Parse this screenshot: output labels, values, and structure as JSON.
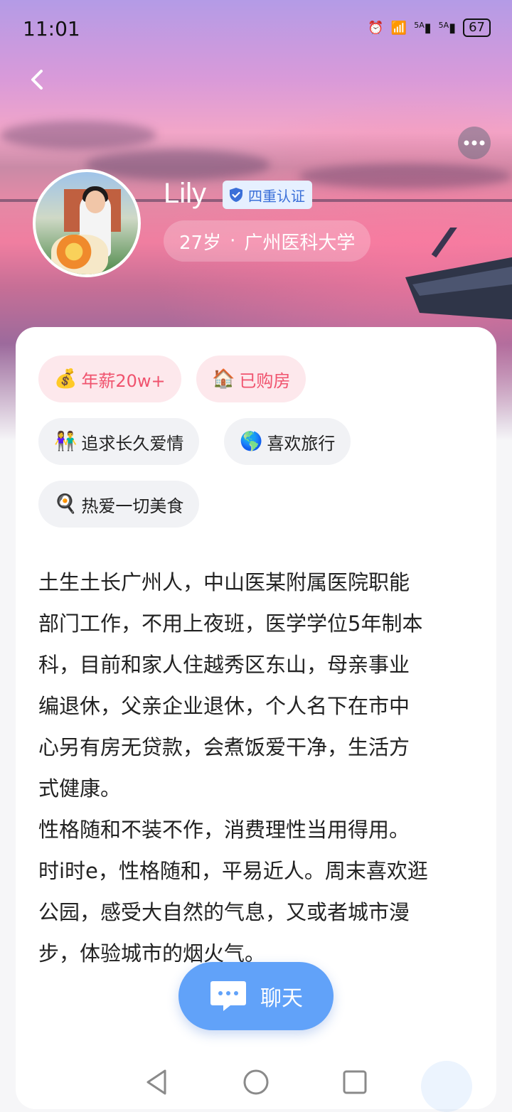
{
  "status_bar": {
    "time": "11:01",
    "signal1": "5A",
    "signal2": "5A",
    "battery": "67"
  },
  "profile": {
    "name": "Lily",
    "verification": "四重认证",
    "age": "27岁",
    "separator": "·",
    "school": "广州医科大学"
  },
  "tags": [
    {
      "emoji": "💰",
      "label": "年薪20w+",
      "style": "pink"
    },
    {
      "emoji": "🏠",
      "label": "已购房",
      "style": "pink"
    },
    {
      "emoji": "👫",
      "label": "追求长久爱情",
      "style": "grey"
    },
    {
      "emoji": "🌎",
      "label": "喜欢旅行",
      "style": "grey"
    },
    {
      "emoji": "🍳",
      "label": "热爱一切美食",
      "style": "grey"
    }
  ],
  "bio": "土生土长广州人，中山医某附属医院职能\n部门工作，不用上夜班，医学学位5年制本\n科，目前和家人住越秀区东山，母亲事业\n编退休，父亲企业退休，个人名下在市中\n心另有房无贷款，会煮饭爱干净，生活方\n式健康。\n性格随和不装不作，消费理性当用得用。\n时i时e，性格随和，平易近人。周末喜欢逛\n公园，感受大自然的气息，又或者城市漫\n步，体验城市的烟火气。",
  "chat_button": {
    "label": "聊天"
  },
  "colors": {
    "accent": "#61a2f9",
    "tag_pink_bg": "#fde8ec",
    "tag_pink_text": "#f0536e",
    "verify_blue": "#3a6fd8"
  },
  "icons": [
    "back-icon",
    "more-icon",
    "verified-shield-icon",
    "chat-bubble-icon",
    "nav-back-icon",
    "nav-home-icon",
    "nav-recents-icon"
  ]
}
